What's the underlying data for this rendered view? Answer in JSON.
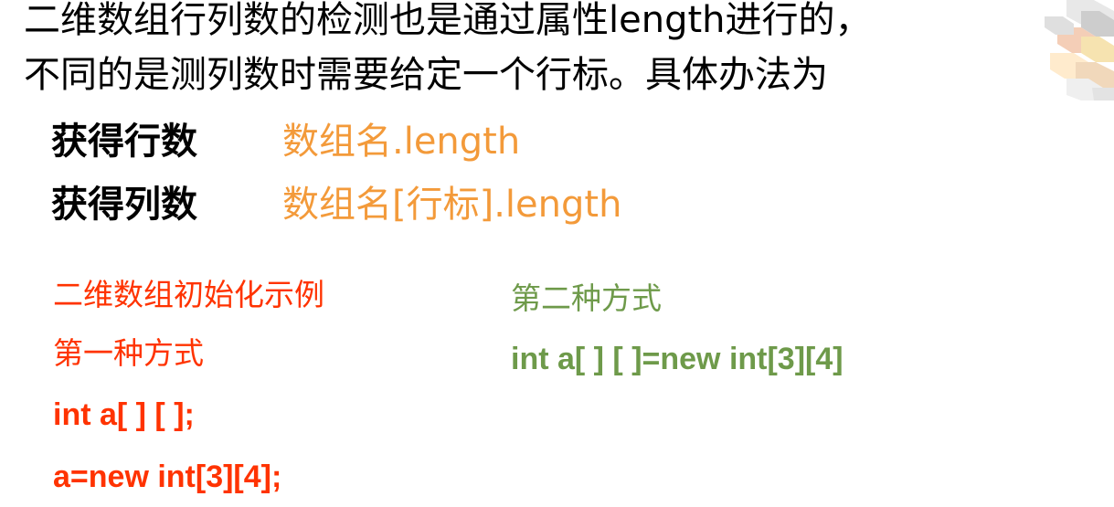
{
  "intro": {
    "line1": "二维数组行列数的检测也是通过属性length进行的，",
    "line2": "不同的是测列数时需要给定一个行标。具体办法为"
  },
  "rows": [
    {
      "label": "获得行数",
      "value": "数组名.length"
    },
    {
      "label": "获得列数",
      "value": "数组名[行标].length"
    }
  ],
  "example": {
    "title": "二维数组初始化示例",
    "method1": {
      "name": "第一种方式",
      "code_line1": "int a[ ] [ ];",
      "code_line2": "a=new int[3][4];"
    },
    "method2": {
      "name": "第二种方式",
      "code_line1": "int a[ ] [ ]=new int[3][4]"
    }
  },
  "colors": {
    "orange": "#F39A3A",
    "red": "#FF3300",
    "green": "#6E9A4A"
  }
}
